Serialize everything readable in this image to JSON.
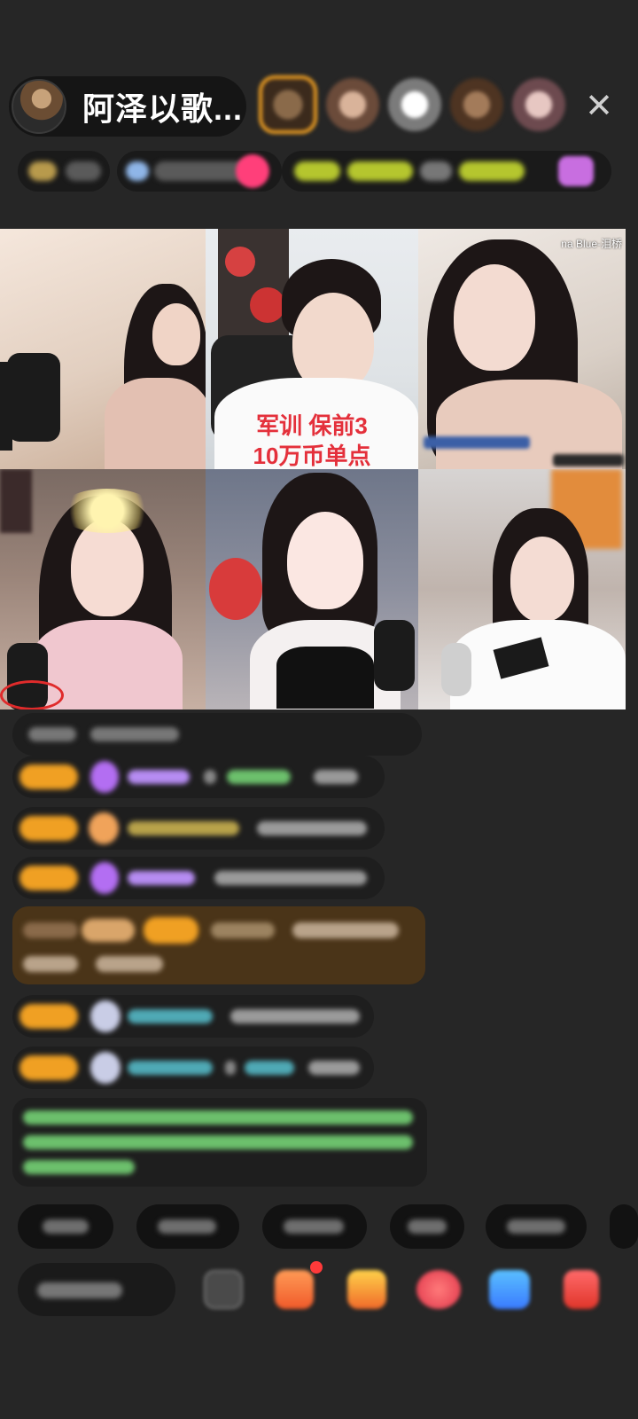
{
  "header": {
    "host_name": "阿泽以歌...",
    "close_icon": "close-icon"
  },
  "video_grid": {
    "tiles": [
      {
        "caption_lines": []
      },
      {
        "caption_lines": [
          "军训 保前3",
          "10万币单点"
        ]
      },
      {
        "caption_lines": [],
        "tag": "na Blue-泪桥"
      },
      {
        "caption_lines": []
      },
      {
        "caption_lines": []
      },
      {
        "caption_lines": []
      }
    ]
  },
  "colors": {
    "background": "#262626",
    "caption_red": "#e4303b",
    "badge_orange": "#f0a023",
    "name_purple": "#b68cf2",
    "gift_banner": "#4a3418",
    "system_green": "#6cc06c"
  },
  "bottom_bar": {
    "icons": [
      "more-icon",
      "gift-box-icon",
      "fan-club-icon",
      "pk-icon",
      "message-icon",
      "shop-icon"
    ]
  }
}
